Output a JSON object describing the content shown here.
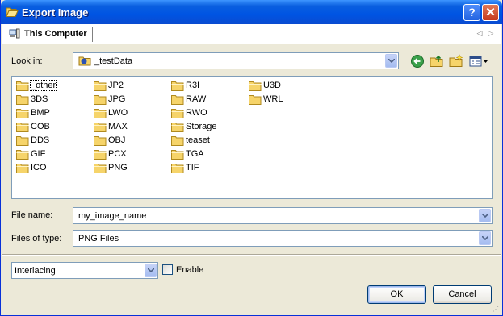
{
  "window": {
    "title": "Export Image",
    "help_glyph": "?",
    "close_glyph": "✕"
  },
  "tabs": {
    "active": "This Computer"
  },
  "look_in": {
    "label": "Look in:",
    "value": "_testData"
  },
  "files": [
    {
      "name": "_other"
    },
    {
      "name": "3DS"
    },
    {
      "name": "BMP"
    },
    {
      "name": "COB"
    },
    {
      "name": "DDS"
    },
    {
      "name": "GIF"
    },
    {
      "name": "ICO"
    },
    {
      "name": "JP2"
    },
    {
      "name": "JPG"
    },
    {
      "name": "LWO"
    },
    {
      "name": "MAX"
    },
    {
      "name": "OBJ"
    },
    {
      "name": "PCX"
    },
    {
      "name": "PNG"
    },
    {
      "name": "R3I"
    },
    {
      "name": "RAW"
    },
    {
      "name": "RWO"
    },
    {
      "name": "Storage"
    },
    {
      "name": "teaset"
    },
    {
      "name": "TGA"
    },
    {
      "name": "TIF"
    },
    {
      "name": "U3D"
    },
    {
      "name": "WRL"
    }
  ],
  "file_name": {
    "label": "File name:",
    "value": "my_image_name"
  },
  "file_type": {
    "label": "Files of type:",
    "value": "PNG Files"
  },
  "options": {
    "interlacing": "Interlacing",
    "enable_label": "Enable",
    "enabled": false
  },
  "buttons": {
    "ok": "OK",
    "cancel": "Cancel"
  },
  "colors": {
    "title_bar": "#0054e3",
    "dialog_bg": "#ece9d8",
    "folder": "#f4d46a",
    "field_border": "#7f9db9"
  }
}
